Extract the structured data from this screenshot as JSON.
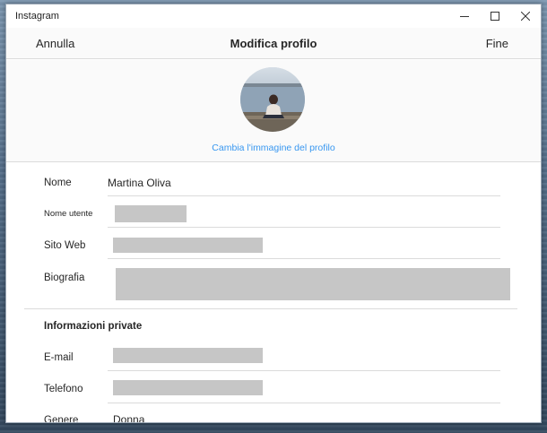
{
  "window": {
    "app_title": "Instagram"
  },
  "header": {
    "cancel_label": "Annulla",
    "title": "Modifica profilo",
    "done_label": "Fine"
  },
  "photo": {
    "change_label": "Cambia l'immagine del profilo"
  },
  "form": {
    "name_label": "Nome",
    "name_value": "Martina Oliva",
    "username_label": "Nome utente",
    "website_label": "Sito Web",
    "bio_label": "Biografia",
    "private_section_title": "Informazioni private",
    "email_label": "E-mail",
    "phone_label": "Telefono",
    "gender_label": "Genere",
    "gender_value": "Donna"
  },
  "icons": {
    "minimize": "minimize-icon",
    "maximize": "maximize-icon",
    "close": "close-icon"
  }
}
